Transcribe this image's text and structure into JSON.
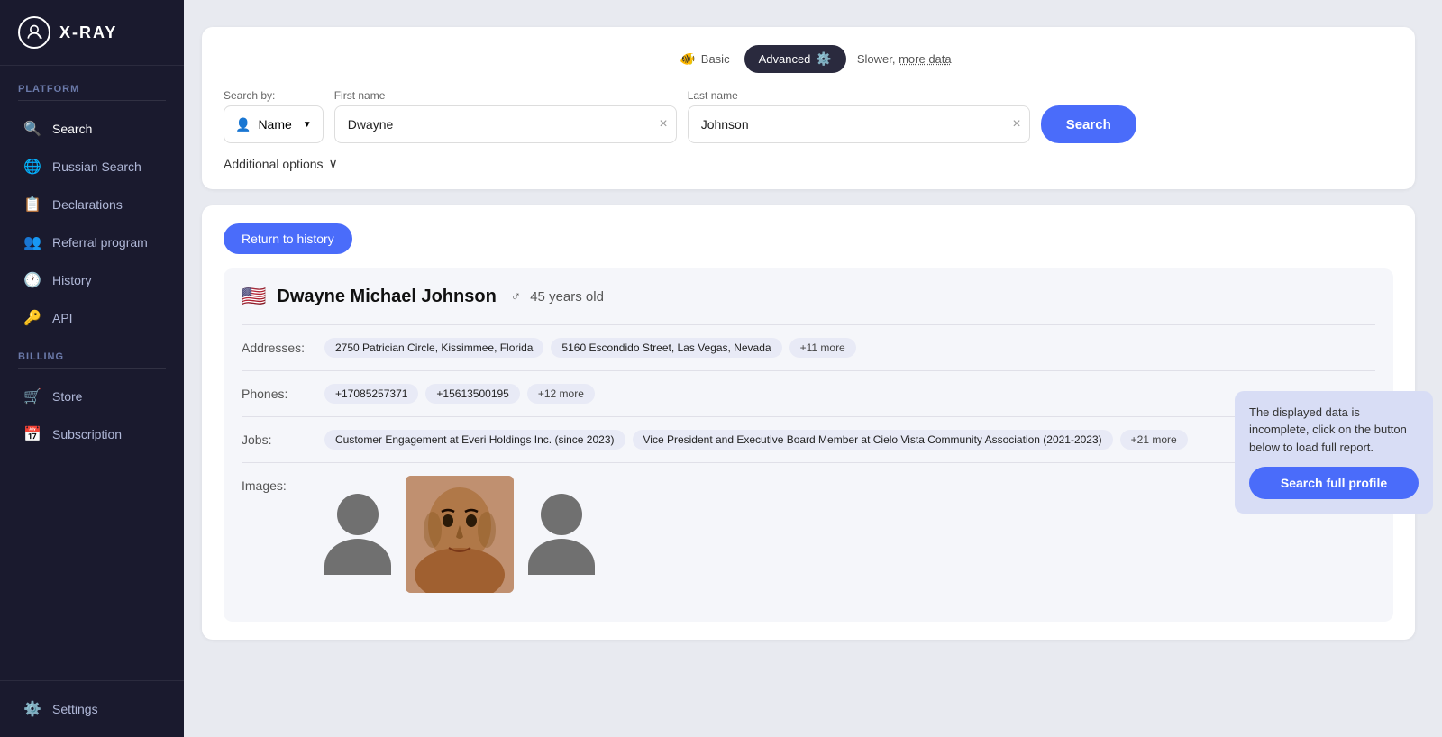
{
  "sidebar": {
    "logo_text": "X-RAY",
    "platform_label": "Platform",
    "billing_label": "Billing",
    "items_platform": [
      {
        "id": "search",
        "label": "Search",
        "icon": "🔍"
      },
      {
        "id": "russian-search",
        "label": "Russian Search",
        "icon": "🌐"
      },
      {
        "id": "declarations",
        "label": "Declarations",
        "icon": "📋"
      },
      {
        "id": "referral",
        "label": "Referral program",
        "icon": "👥"
      },
      {
        "id": "history",
        "label": "History",
        "icon": "🕐"
      },
      {
        "id": "api",
        "label": "API",
        "icon": "🔑"
      }
    ],
    "items_billing": [
      {
        "id": "store",
        "label": "Store",
        "icon": "🛒"
      },
      {
        "id": "subscription",
        "label": "Subscription",
        "icon": "📅"
      }
    ],
    "settings_label": "Settings",
    "settings_icon": "⚙️"
  },
  "search": {
    "mode_basic": "Basic",
    "mode_advanced": "Advanced",
    "slower_text": "Slower, more data",
    "search_by_label": "Search by:",
    "search_by_value": "Name",
    "first_name_label": "First name",
    "first_name_value": "Dwayne",
    "last_name_label": "Last name",
    "last_name_value": "Johnson",
    "search_button": "Search",
    "additional_options": "Additional options"
  },
  "results": {
    "return_button": "Return to history",
    "person_name": "Dwayne Michael Johnson",
    "person_gender": "♂",
    "person_age": "45 years old",
    "addresses_label": "Addresses:",
    "addresses": [
      "2750 Patrician Circle, Kissimmee, Florida",
      "5160 Escondido Street, Las Vegas, Nevada",
      "+11 more"
    ],
    "phones_label": "Phones:",
    "phones": [
      "+17085257371",
      "+15613500195",
      "+12 more"
    ],
    "jobs_label": "Jobs:",
    "jobs": [
      "Customer Engagement at Everi Holdings Inc. (since 2023)",
      "Vice President and Executive Board Member at Cielo Vista Community Association (2021-2023)",
      "+21 more"
    ],
    "images_label": "Images:",
    "tooltip_text": "The displayed data is incomplete, click on the button below to load full report.",
    "search_full_profile": "Search full profile"
  }
}
